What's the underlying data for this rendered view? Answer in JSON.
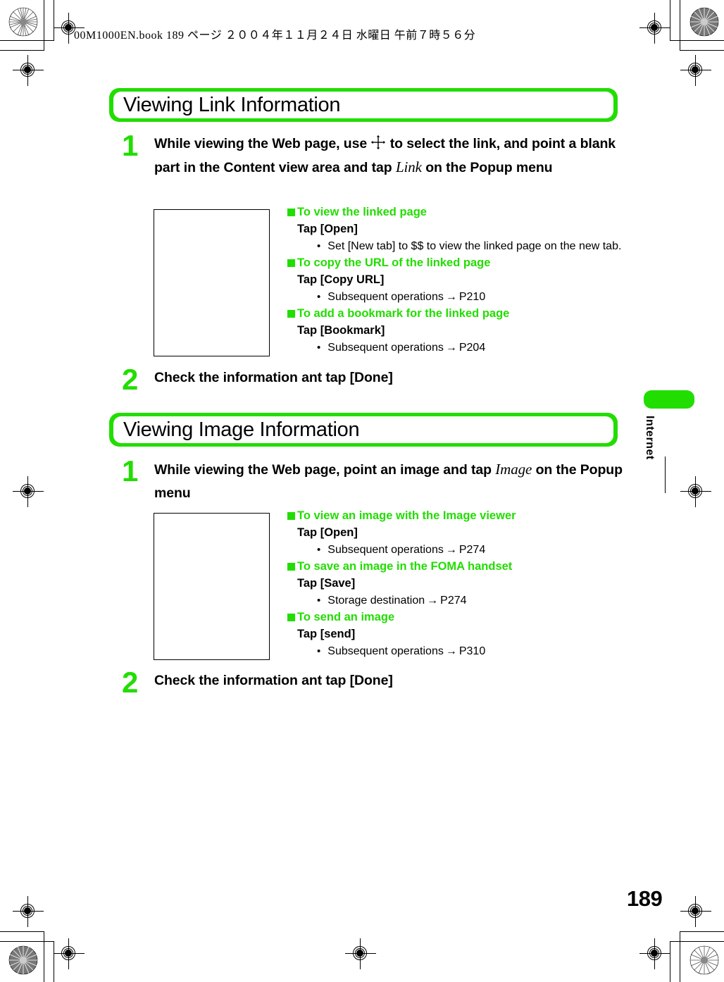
{
  "page": {
    "book_header": "00M1000EN.book    189 ページ    ２００４年１１月２４日    水曜日    午前７時５６分",
    "page_number": "189",
    "accent_color": "#22dd00",
    "side_tab_label": "Internet"
  },
  "sections": [
    {
      "title": "Viewing Link Information",
      "steps": [
        {
          "number": "1",
          "text_before_icon": "While viewing the Web page, use ",
          "icon": "dpad-four-direction-icon",
          "text_after_icon_1": " to select the link, and point a blank part in the Content view area and tap ",
          "emphasis": "Link",
          "text_after_icon_2": " on the Popup menu"
        },
        {
          "number": "2",
          "text": "Check the information ant tap [Done]"
        }
      ],
      "screenshot_placeholder": "link-info-screenshot",
      "subsections": [
        {
          "heading": "To view the linked page",
          "tap": "Tap [Open]",
          "bullets": [
            {
              "text": "Set [New tab] to $$ to view the linked page on the new tab.",
              "arrow": "",
              "ref": ""
            }
          ]
        },
        {
          "heading": "To copy the URL of the linked page",
          "tap": "Tap [Copy URL]",
          "bullets": [
            {
              "text": "Subsequent operations",
              "arrow": "→",
              "ref": "P210"
            }
          ]
        },
        {
          "heading": "To add a bookmark for the linked page",
          "tap": "Tap [Bookmark]",
          "bullets": [
            {
              "text": "Subsequent operations",
              "arrow": "→",
              "ref": "P204"
            }
          ]
        }
      ]
    },
    {
      "title": "Viewing Image Information",
      "steps": [
        {
          "number": "1",
          "text_before_icon": "While viewing the Web page, point an image and tap ",
          "icon": "",
          "text_after_icon_1": "",
          "emphasis": "Image",
          "text_after_icon_2": " on the Popup menu"
        },
        {
          "number": "2",
          "text": "Check the information ant tap [Done]"
        }
      ],
      "screenshot_placeholder": "image-info-screenshot",
      "subsections": [
        {
          "heading": "To view an image with the Image viewer",
          "tap": "Tap [Open]",
          "bullets": [
            {
              "text": "Subsequent operations",
              "arrow": "→",
              "ref": "P274"
            }
          ]
        },
        {
          "heading": "To save an image in the FOMA handset",
          "tap": "Tap [Save]",
          "bullets": [
            {
              "text": "Storage destination",
              "arrow": "→",
              "ref": "P274"
            }
          ]
        },
        {
          "heading": "To send an image",
          "tap": "Tap [send]",
          "bullets": [
            {
              "text": "Subsequent operations",
              "arrow": "→",
              "ref": "P310"
            }
          ]
        }
      ]
    }
  ]
}
